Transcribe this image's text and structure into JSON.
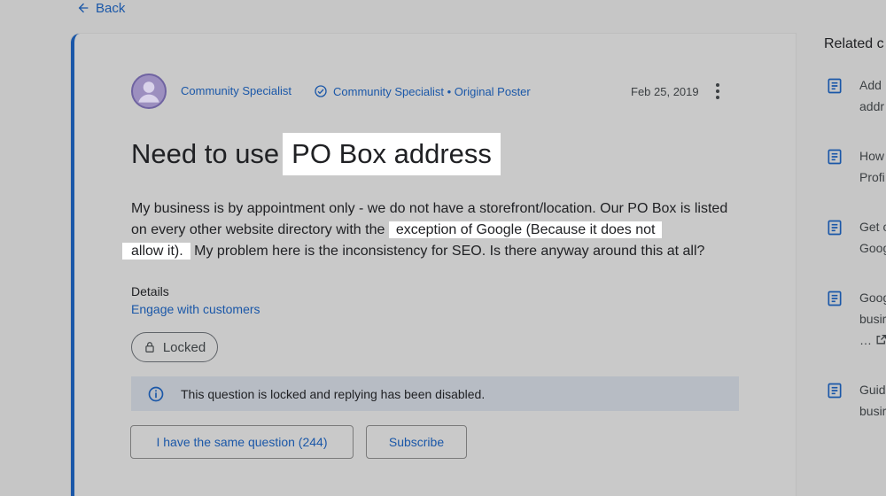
{
  "nav": {
    "back_label": "Back"
  },
  "post": {
    "author": "Community Specialist",
    "badge_label": "Community Specialist • Original Poster",
    "date": "Feb 25, 2019",
    "title_prefix": "Need to use",
    "title_highlight": "PO Box address",
    "body_part1": "My business is by appointment only - we do not have a storefront/location.  Our PO Box is listed on every other website directory with the",
    "body_highlight1": "exception of Google (Because it does not",
    "body_highlight2": "allow it).",
    "body_part2": "My problem here is the inconsistency for SEO.  Is there anyway around this at all?",
    "details_label": "Details",
    "details_link": "Engage with customers",
    "locked_label": "Locked",
    "notice_text": "This question is locked and replying has been disabled.",
    "same_question_label": "I have the same question (244)",
    "subscribe_label": "Subscribe"
  },
  "related": {
    "title": "Related c",
    "items": [
      {
        "line1": "Add",
        "line2": "addr"
      },
      {
        "line1": "How",
        "line2": "Profi"
      },
      {
        "line1": "Get c",
        "line2": "Goog"
      },
      {
        "line1": "Goog",
        "line2": "busir",
        "line3": "…"
      },
      {
        "line1": "Guid",
        "line2": "busir"
      }
    ]
  },
  "colors": {
    "accent": "#1a57a8",
    "background": "#c6c6c6",
    "notice_bg": "#b7bcc4"
  }
}
